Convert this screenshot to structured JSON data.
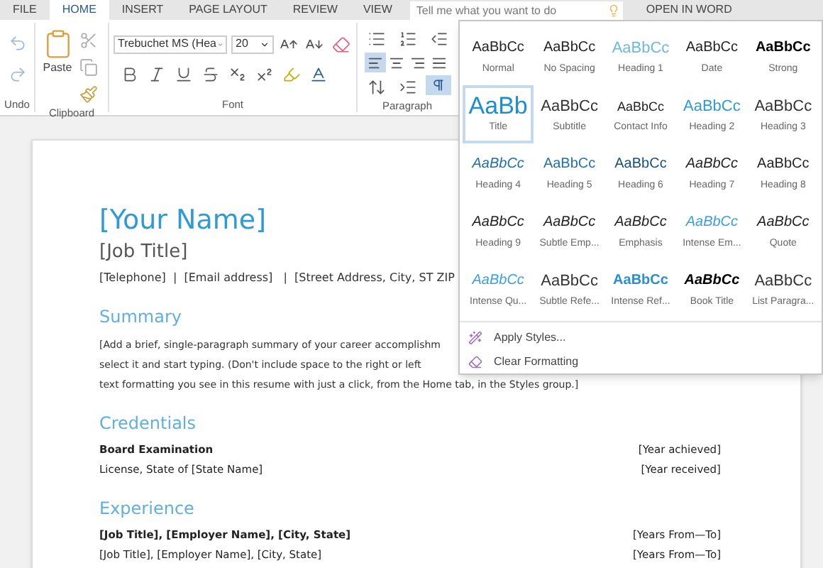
{
  "tabs": [
    {
      "label": "FILE",
      "selected": false
    },
    {
      "label": "HOME",
      "selected": true
    },
    {
      "label": "INSERT",
      "selected": false
    },
    {
      "label": "PAGE LAYOUT",
      "selected": false
    },
    {
      "label": "REVIEW",
      "selected": false
    },
    {
      "label": "VIEW",
      "selected": false
    }
  ],
  "search": {
    "placeholder": "Tell me what you want to do"
  },
  "open_in_word": "OPEN IN WORD",
  "ribbon": {
    "undo_group": "Undo",
    "clipboard_group": "Clipboard",
    "paste": "Paste",
    "font_group": "Font",
    "font_name": "Trebuchet MS (Hea",
    "font_size": "20",
    "paragraph_group": "Paragraph",
    "alignment": [
      {
        "kind": "left",
        "selected": true
      },
      {
        "kind": "center",
        "selected": false
      },
      {
        "kind": "right",
        "selected": false
      },
      {
        "kind": "justify",
        "selected": false
      }
    ],
    "ltr_selected": true
  },
  "styles_gallery": {
    "styles": [
      {
        "preview": "AaBbCc",
        "label": "Normal",
        "kind": "normal",
        "selected": false
      },
      {
        "preview": "AaBbCc",
        "label": "No Spacing",
        "kind": "normal",
        "selected": false
      },
      {
        "preview": "AaBbCc",
        "label": "Heading 1",
        "kind": "light-heading",
        "selected": false
      },
      {
        "preview": "AaBbCc",
        "label": "Date",
        "kind": "normal",
        "selected": false
      },
      {
        "preview": "AaBbCc",
        "label": "Strong",
        "kind": "bold",
        "selected": false
      },
      {
        "preview": "AaBb",
        "label": "Title",
        "kind": "title",
        "selected": true
      },
      {
        "preview": "AaBbCc",
        "label": "Subtitle",
        "kind": "large",
        "selected": false
      },
      {
        "preview": "AaBbCc",
        "label": "Contact Info",
        "kind": "small",
        "selected": false
      },
      {
        "preview": "AaBbCc",
        "label": "Heading 2",
        "kind": "heading",
        "selected": false
      },
      {
        "preview": "AaBbCc",
        "label": "Heading 3",
        "kind": "large",
        "selected": false
      },
      {
        "preview": "AaBbCc",
        "label": "Heading 4",
        "kind": "italic-accent",
        "selected": false
      },
      {
        "preview": "AaBbCc",
        "label": "Heading 5",
        "kind": "accent",
        "selected": false
      },
      {
        "preview": "AaBbCc",
        "label": "Heading 6",
        "kind": "dark-accent",
        "selected": false
      },
      {
        "preview": "AaBbCc",
        "label": "Heading 7",
        "kind": "italic",
        "selected": false
      },
      {
        "preview": "AaBbCc",
        "label": "Heading 8",
        "kind": "normal",
        "selected": false
      },
      {
        "preview": "AaBbCc",
        "label": "Heading 9",
        "kind": "italic",
        "selected": false
      },
      {
        "preview": "AaBbCc",
        "label": "Subtle Emp...",
        "kind": "italic",
        "selected": false
      },
      {
        "preview": "AaBbCc",
        "label": "Emphasis",
        "kind": "italic",
        "selected": false
      },
      {
        "preview": "AaBbCc",
        "label": "Intense Em...",
        "kind": "italic-light",
        "selected": false
      },
      {
        "preview": "AaBbCc",
        "label": "Quote",
        "kind": "italic",
        "selected": false
      },
      {
        "preview": "AaBbCc",
        "label": "Intense Qu...",
        "kind": "italic-light",
        "selected": false
      },
      {
        "preview": "AaBbCc",
        "label": "Subtle Refe...",
        "kind": "large",
        "selected": false
      },
      {
        "preview": "AaBbCc",
        "label": "Intense Ref...",
        "kind": "bold-accent",
        "selected": false
      },
      {
        "preview": "AaBbCc",
        "label": "Book Title",
        "kind": "bold-italic",
        "selected": false
      },
      {
        "preview": "AaBbCc",
        "label": "List Paragra...",
        "kind": "large",
        "selected": false
      }
    ],
    "actions": [
      {
        "label": "Apply Styles...",
        "kind": "apply"
      },
      {
        "label": "Clear Formatting",
        "kind": "clear"
      }
    ]
  },
  "document": {
    "name": "[Your Name]",
    "job_title": "[Job Title]",
    "contact": "[Telephone]  |  [Email address]   |  [Street Address, City, ST ZIP",
    "sections": [
      {
        "heading": "Summary",
        "paragraph_lines": [
          "[Add a brief, single-paragraph summary of your career accomplishm",
          "select it and start typing. (Don't include space to the right or left",
          "text formatting you see in this resume with just a click, from the Home tab, in the Styles group.]"
        ]
      },
      {
        "heading": "Credentials",
        "rows": [
          {
            "left": "Board Examination",
            "right": "[Year achieved]"
          },
          {
            "left": "License, State of [State Name]",
            "right": "[Year received]"
          }
        ]
      },
      {
        "heading": "Experience",
        "rows": [
          {
            "left": "[Job Title], [Employer Name], [City, State]",
            "right": "[Years From—To]"
          },
          {
            "left": "[Job Title], [Employer Name], [City, State]",
            "right": "[Years From—To]"
          }
        ]
      }
    ]
  }
}
